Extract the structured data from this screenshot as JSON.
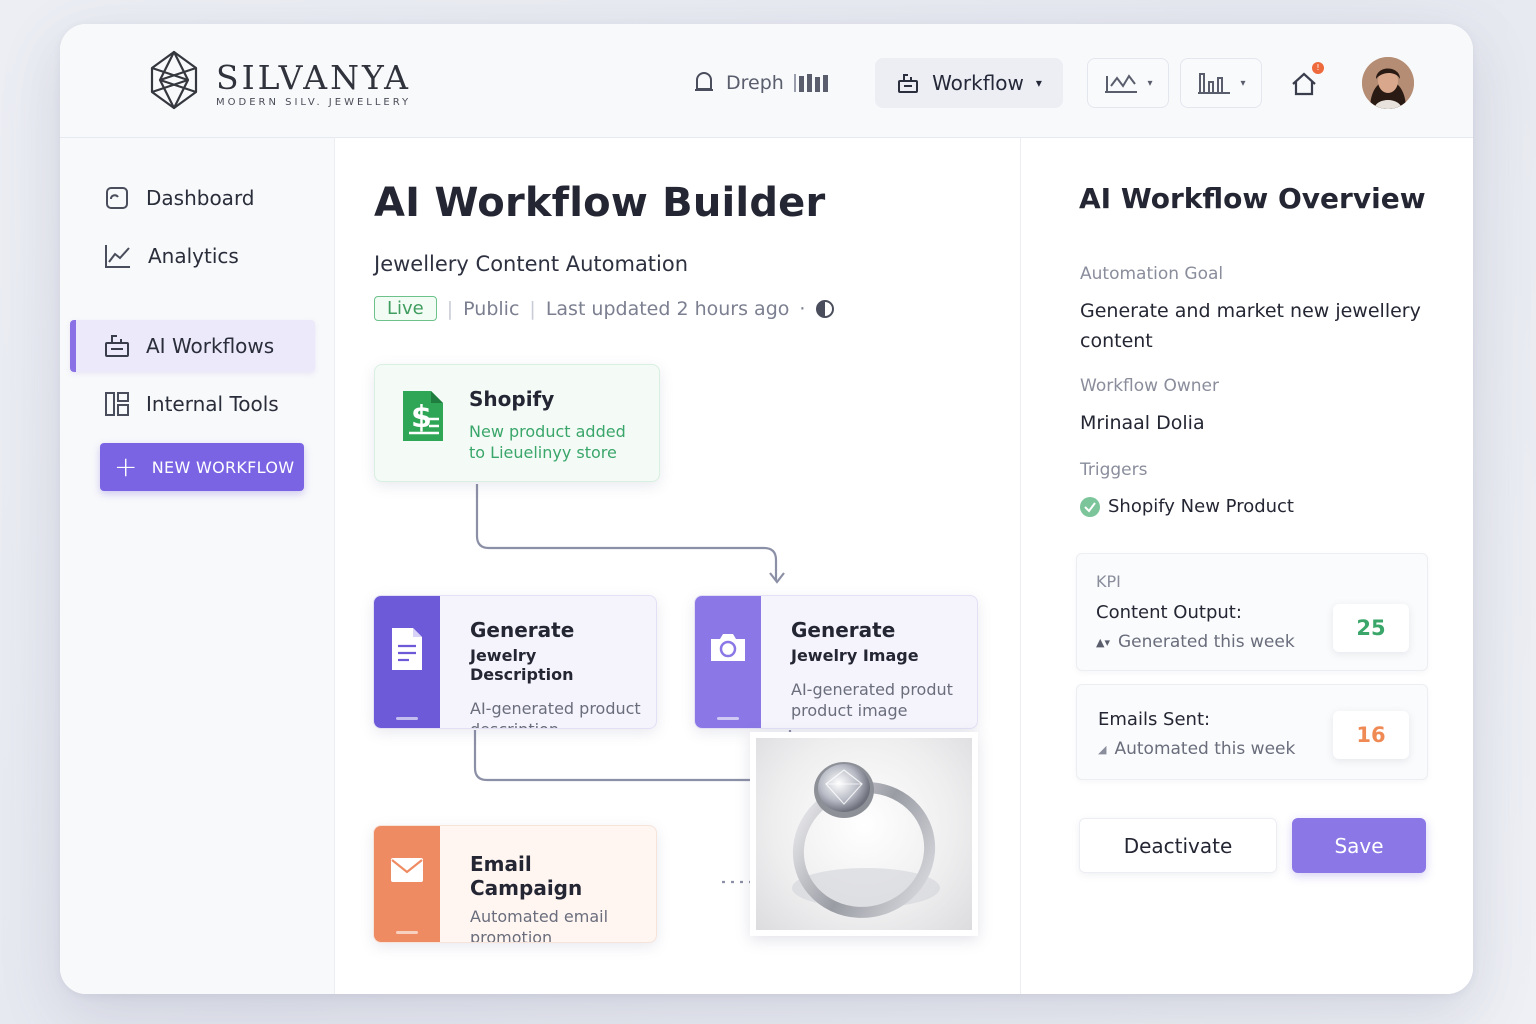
{
  "brand": {
    "name": "SILVANYA",
    "tagline": "MODERN SILV. JEWELLERY"
  },
  "header": {
    "search_label": "Dreph",
    "workflow_label": "Workflow",
    "notification_badge": "!"
  },
  "sidebar": {
    "items": [
      {
        "label": "Dashboard",
        "icon": "dashboard-icon"
      },
      {
        "label": "Analytics",
        "icon": "analytics-icon"
      },
      {
        "label": "AI Workflows",
        "icon": "workflow-icon",
        "active": true
      },
      {
        "label": "Internal Tools",
        "icon": "tools-icon"
      }
    ],
    "new_button": "NEW WORKFLOW"
  },
  "main": {
    "title": "AI Workflow Builder",
    "subtitle": "Jewellery Content Automation",
    "status": "Live",
    "visibility": "Public",
    "updated": "Last updated 2 hours ago",
    "nodes": {
      "shopify": {
        "title": "Shopify",
        "desc_line1": "New product added",
        "desc_line2": "to Lieuelinyy store"
      },
      "description": {
        "title": "Generate",
        "subtitle": "Jewelry Description",
        "desc": "AI-generated product description"
      },
      "image": {
        "title": "Generate",
        "subtitle": "Jewelry Image",
        "desc_line1": "AI-generated produt",
        "desc_line2": "product image"
      },
      "email": {
        "title": "Email Campaign",
        "desc": "Automated email promotion"
      }
    }
  },
  "panel": {
    "title": "AI Workflow Overview",
    "goal_label": "Automation Goal",
    "goal_value": "Generate and market new jewellery content",
    "owner_label": "Workflow Owner",
    "owner_value": "Mrinaal Dolia",
    "triggers_label": "Triggers",
    "trigger_value": "Shopify New Product",
    "kpi_label": "KPI",
    "kpis": [
      {
        "label": "Content Output:",
        "sub": "Generated this week",
        "value": "25",
        "color": "#3aa66a"
      },
      {
        "label": "Emails Sent:",
        "sub": "Automated this week",
        "value": "16",
        "color": "#ef8a55"
      }
    ],
    "deactivate_label": "Deactivate",
    "save_label": "Save"
  },
  "colors": {
    "accent": "#7a64e4",
    "accent_light": "#8b78e6",
    "live_green": "#3f9d5f",
    "email_orange": "#ee8b63"
  }
}
